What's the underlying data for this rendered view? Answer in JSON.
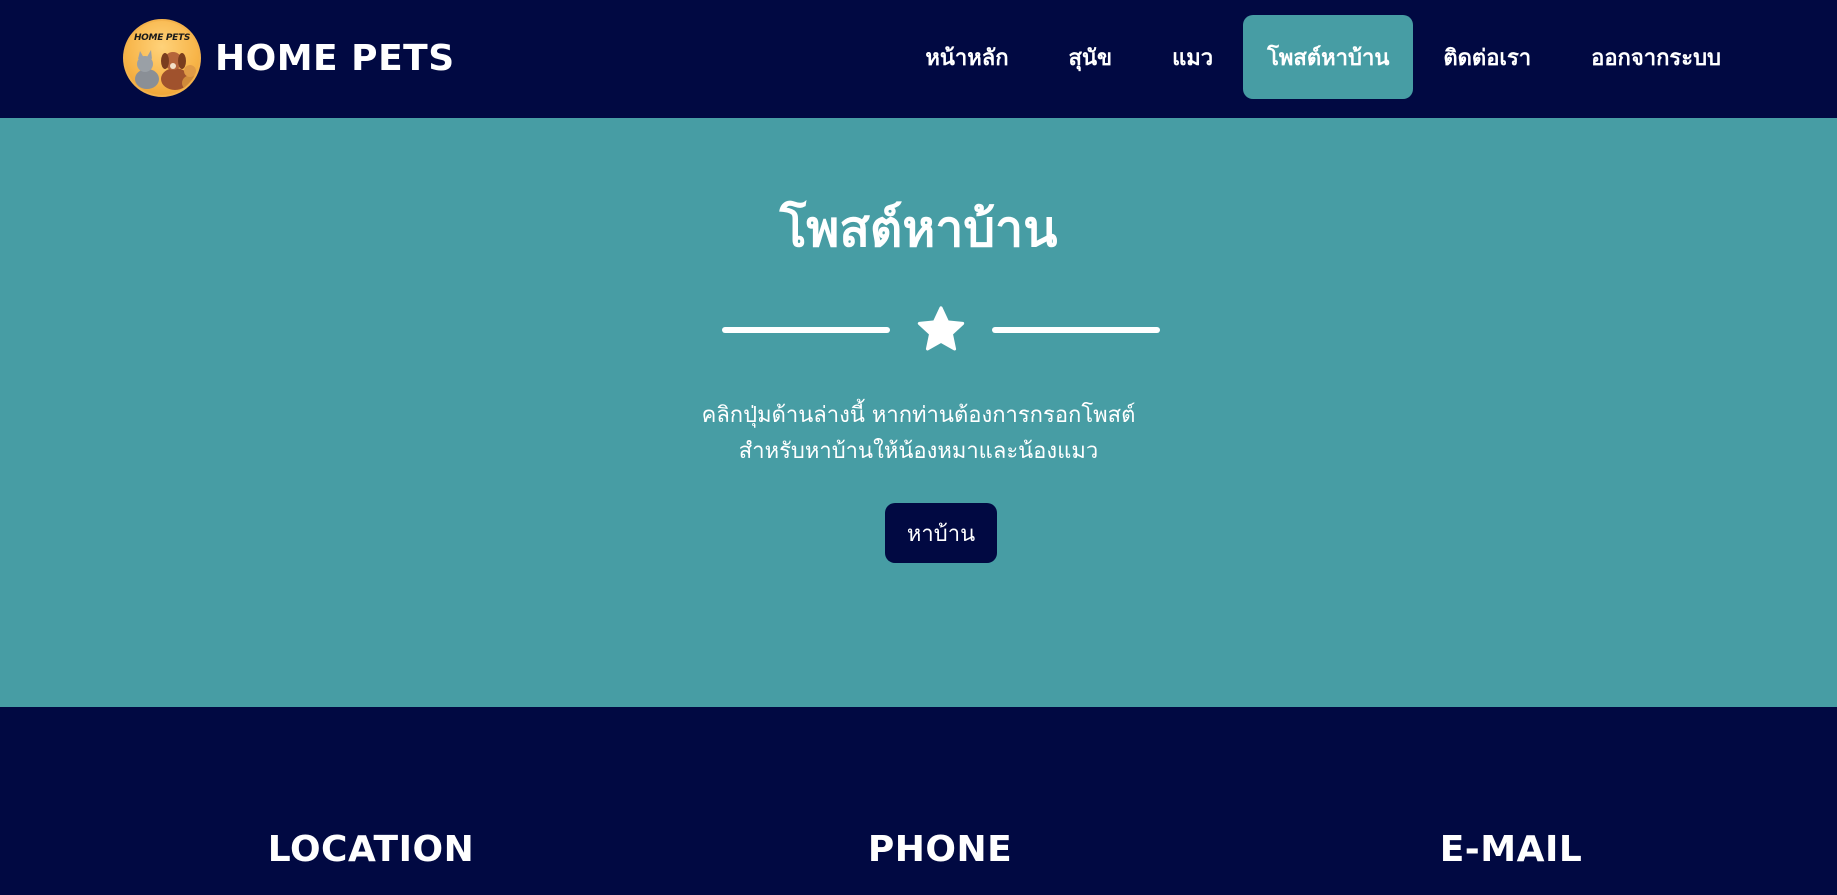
{
  "navbar": {
    "brand_name": "HOME PETS",
    "logo_text": "HOME PETS",
    "links": [
      {
        "label": "หน้าหลัก"
      },
      {
        "label": "สุนัข"
      },
      {
        "label": "แมว"
      },
      {
        "label": "โพสต์หาบ้าน",
        "active": true
      },
      {
        "label": "ติดต่อเรา"
      },
      {
        "label": "ออกจากระบบ"
      }
    ]
  },
  "hero": {
    "title": "โพสต์หาบ้าน",
    "divider_icon": "star-icon",
    "description_line1": "คลิกปุ่มด้านล่างนี้ หากท่านต้องการกรอกโพสต์",
    "description_line2": "สำหรับหาบ้านให้น้องหมาและน้องแมว",
    "button_label": "หาบ้าน"
  },
  "footer": {
    "location_heading": "LOCATION",
    "phone_heading": "PHONE",
    "email_heading": "E-MAIL"
  },
  "colors": {
    "navy": "#010942",
    "teal": "#479da4",
    "white": "#ffffff"
  }
}
